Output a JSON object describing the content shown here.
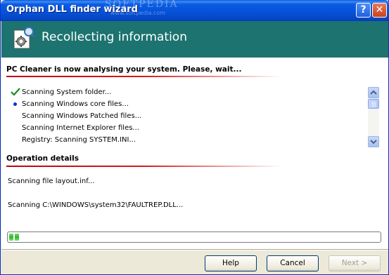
{
  "window": {
    "title": "Orphan DLL finder wizard",
    "watermark": "SOFTPEDIA",
    "watermark_url": "www.softpedia.com",
    "help_label": "?",
    "close_label": "✕"
  },
  "header": {
    "icon": "gear-document-search-icon",
    "heading": "Recollecting information"
  },
  "status": {
    "title": "PC Cleaner is now analysing your system. Please, wait...",
    "items": [
      {
        "icon": "checkmark-icon",
        "label": "Scanning System folder..."
      },
      {
        "icon": "bullet-dot-icon",
        "label": "Scanning Windows core files..."
      },
      {
        "icon": "",
        "label": "Scanning Windows Patched files..."
      },
      {
        "icon": "",
        "label": "Scanning Internet Explorer files..."
      },
      {
        "icon": "",
        "label": "Registry: Scanning SYSTEM.INI..."
      }
    ]
  },
  "details": {
    "title": "Operation details",
    "line1": "Scanning file layout.inf...",
    "line2": "Scanning C:\\WINDOWS\\system32\\FAULTREP.DLL..."
  },
  "progress": {
    "percent": 1
  },
  "buttons": {
    "help": "Help",
    "cancel": "Cancel",
    "next": "Next >"
  },
  "colors": {
    "banner": "#1c7370",
    "accent_line": "#c0000f",
    "progress_fill": "#2fb52a",
    "titlebar": "#0551d8"
  }
}
